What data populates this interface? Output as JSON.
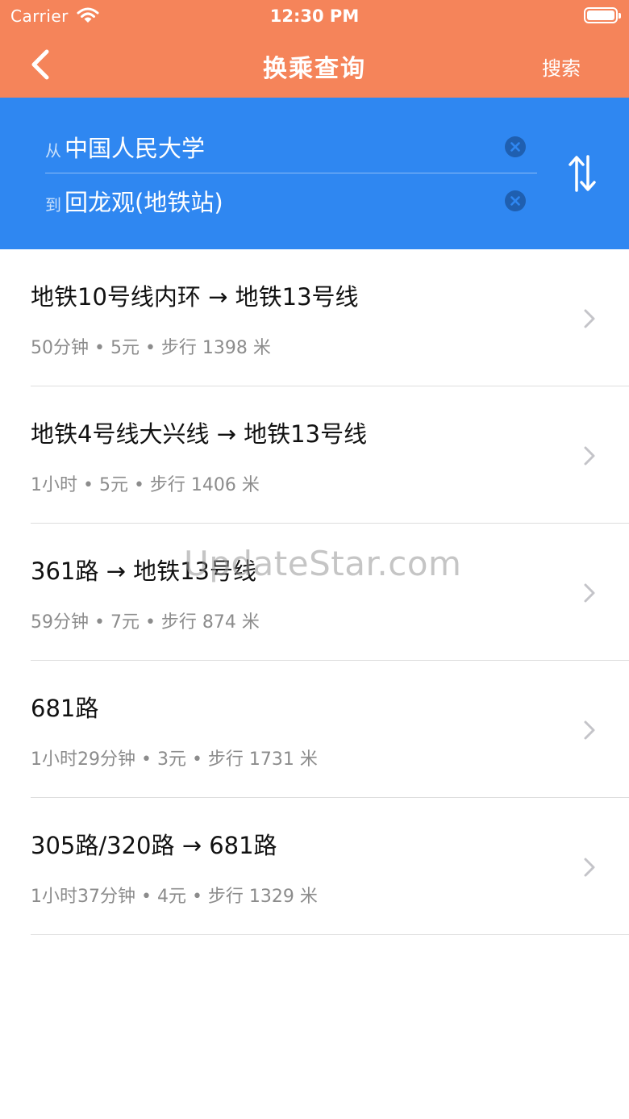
{
  "status_bar": {
    "carrier": "Carrier",
    "time": "12:30 PM"
  },
  "nav": {
    "title": "换乘查询",
    "search_label": "搜索"
  },
  "query": {
    "from_prefix": "从",
    "from_value": "中国人民大学",
    "to_prefix": "到",
    "to_value": "回龙观(地铁站)"
  },
  "routes": [
    {
      "title": "地铁10号线内环 → 地铁13号线",
      "detail": "50分钟 • 5元 • 步行 1398 米"
    },
    {
      "title": "地铁4号线大兴线 → 地铁13号线",
      "detail": "1小时 • 5元 • 步行 1406 米"
    },
    {
      "title": "361路 → 地铁13号线",
      "detail": "59分钟 • 7元 • 步行 874 米"
    },
    {
      "title": "681路",
      "detail": "1小时29分钟 • 3元 • 步行 1731 米"
    },
    {
      "title": "305路/320路 → 681路",
      "detail": "1小时37分钟 • 4元 • 步行 1329 米"
    }
  ],
  "watermark": "UpdateStar.com",
  "colors": {
    "header": "#f5845a",
    "query_bg": "#2f87f1",
    "clear_icon": "#1f5fb0"
  }
}
